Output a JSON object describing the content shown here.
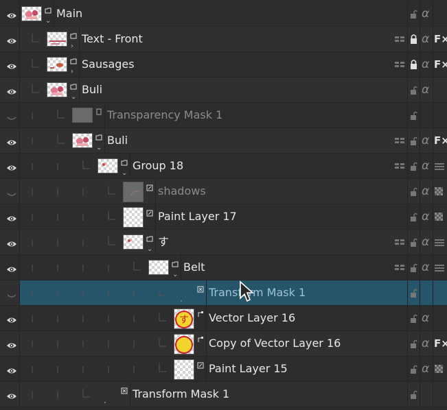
{
  "layers": [
    {
      "name": "Main",
      "depth": 0,
      "kind": "group",
      "thumb": "pink-art",
      "expanded": true,
      "visible": true,
      "dim": false,
      "lock": "unlocked",
      "fx": false,
      "inherit": false,
      "alpha_icon": "alpha",
      "status": "normal"
    },
    {
      "name": "Text - Front",
      "depth": 1,
      "kind": "group",
      "thumb": "text",
      "expanded": false,
      "visible": true,
      "dim": false,
      "lock": "locked",
      "fx": true,
      "inherit": true,
      "alpha_icon": "alpha",
      "status": "normal"
    },
    {
      "name": "Sausages",
      "depth": 1,
      "kind": "group",
      "thumb": "sausage",
      "expanded": false,
      "visible": true,
      "dim": false,
      "lock": "locked",
      "fx": true,
      "inherit": true,
      "alpha_icon": "alpha",
      "status": "normal"
    },
    {
      "name": "Buli",
      "depth": 1,
      "kind": "group",
      "thumb": "pink-art",
      "expanded": true,
      "visible": true,
      "dim": false,
      "lock": "unlocked",
      "fx": false,
      "inherit": false,
      "alpha_icon": "alpha",
      "status": "normal"
    },
    {
      "name": "Transparency Mask 1",
      "depth": 2,
      "kind": "mask",
      "thumb": "gray",
      "expanded": null,
      "visible": false,
      "dim": true,
      "lock": "unlocked",
      "fx": false,
      "inherit": false,
      "alpha_icon": "none",
      "status": "normal"
    },
    {
      "name": "Buli",
      "depth": 2,
      "kind": "group",
      "thumb": "pink-art",
      "expanded": true,
      "visible": true,
      "dim": false,
      "lock": "unlocked",
      "fx": true,
      "inherit": true,
      "alpha_icon": "alpha",
      "status": "normal"
    },
    {
      "name": "Group 18",
      "depth": 3,
      "kind": "group",
      "thumb": "small-art",
      "expanded": true,
      "visible": true,
      "dim": false,
      "lock": "unlocked",
      "fx": false,
      "inherit": true,
      "alpha_icon": "alpha",
      "status": "normal"
    },
    {
      "name": "shadows",
      "depth": 4,
      "kind": "paint",
      "thumb": "gray-art",
      "expanded": null,
      "visible": false,
      "dim": true,
      "lock": "unlocked",
      "fx": false,
      "inherit": false,
      "alpha_icon": "alpha",
      "status": "checker"
    },
    {
      "name": "Paint Layer 17",
      "depth": 4,
      "kind": "paint",
      "thumb": "empty",
      "expanded": null,
      "visible": true,
      "dim": false,
      "lock": "unlocked",
      "fx": false,
      "inherit": false,
      "alpha_icon": "alpha",
      "status": "checker"
    },
    {
      "name": "す",
      "depth": 4,
      "kind": "group",
      "thumb": "small-art",
      "expanded": true,
      "visible": true,
      "dim": false,
      "lock": "unlocked",
      "fx": false,
      "inherit": true,
      "alpha_icon": "alpha",
      "status": "normal"
    },
    {
      "name": "Belt",
      "depth": 5,
      "kind": "group",
      "thumb": "empty",
      "expanded": true,
      "visible": true,
      "dim": false,
      "lock": "unlocked",
      "fx": false,
      "inherit": true,
      "alpha_icon": "alpha",
      "status": "normal"
    },
    {
      "name": "Transform Mask 1",
      "depth": 6,
      "kind": "transform",
      "thumb": "none",
      "expanded": null,
      "visible": false,
      "dim": false,
      "lock": "unlocked",
      "fx": false,
      "inherit": false,
      "alpha_icon": "none",
      "status": "normal",
      "selected": true
    },
    {
      "name": "Vector Layer 16",
      "depth": 6,
      "kind": "vector",
      "thumb": "vector-su",
      "expanded": null,
      "visible": true,
      "dim": false,
      "lock": "unlocked",
      "fx": false,
      "inherit": false,
      "alpha_icon": "alpha",
      "status": "normal"
    },
    {
      "name": "Copy of Vector Layer 16",
      "depth": 6,
      "kind": "vector",
      "thumb": "vector-circle",
      "expanded": null,
      "visible": true,
      "dim": false,
      "lock": "unlocked",
      "fx": true,
      "inherit": false,
      "alpha_icon": "alpha",
      "status": "normal"
    },
    {
      "name": "Paint Layer 15",
      "depth": 6,
      "kind": "paint",
      "thumb": "empty",
      "expanded": null,
      "visible": true,
      "dim": false,
      "lock": "unlocked",
      "fx": false,
      "inherit": false,
      "alpha_icon": "alpha",
      "status": "checker"
    },
    {
      "name": "Transform Mask 1",
      "depth": 3,
      "kind": "transform",
      "thumb": "none",
      "expanded": null,
      "visible": true,
      "dim": false,
      "lock": "unlocked",
      "fx": false,
      "inherit": false,
      "alpha_icon": "none",
      "status": "normal"
    }
  ],
  "labels": {
    "fx_symbol": "F×",
    "alpha_symbol": "α",
    "expand_open": "⌄",
    "expand_closed": "›"
  },
  "colors": {
    "panel_bg": "#2d2d2d",
    "selected_bg": "#265468",
    "text": "#e8e8e8",
    "dim_text": "#8c8c8c"
  }
}
